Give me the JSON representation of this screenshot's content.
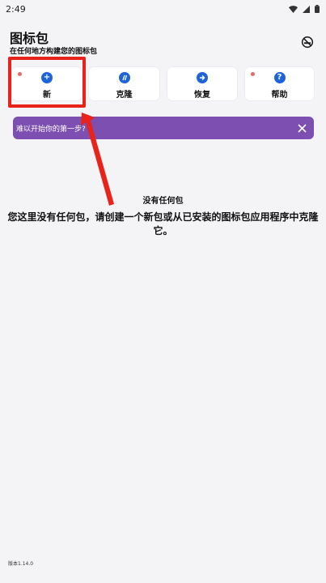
{
  "status": {
    "time": "2:49",
    "icons": [
      "wifi-icon",
      "signal-icon",
      "battery-icon"
    ]
  },
  "header": {
    "title": "图标包",
    "subtitle": "在任何地方构建您的图标包",
    "action_icon": "no-smoking-icon"
  },
  "actions": [
    {
      "label": "新",
      "icon": "plus-icon",
      "glyph": "+",
      "dot": true
    },
    {
      "label": "克隆",
      "icon": "clone-icon",
      "glyph": "⁄⁄",
      "dot": false
    },
    {
      "label": "恢复",
      "icon": "restore-arrow-icon",
      "glyph": "➜",
      "dot": false
    },
    {
      "label": "帮助",
      "icon": "help-icon",
      "glyph": "?",
      "dot": true
    }
  ],
  "tip": {
    "text": "难以开始你的第一步?",
    "close_icon": "close-icon"
  },
  "empty_state": {
    "title": "没有任何包",
    "description": "您这里没有任何包，请创建一个新包或从已安装的图标包应用程序中克隆它。"
  },
  "footer": {
    "version": "版本1.14.0"
  },
  "colors": {
    "accent": "#1d64d8",
    "banner": "#7c4fb0",
    "highlight": "#e8231b",
    "dot": "#e46a6a",
    "background": "#f4f4f7"
  }
}
